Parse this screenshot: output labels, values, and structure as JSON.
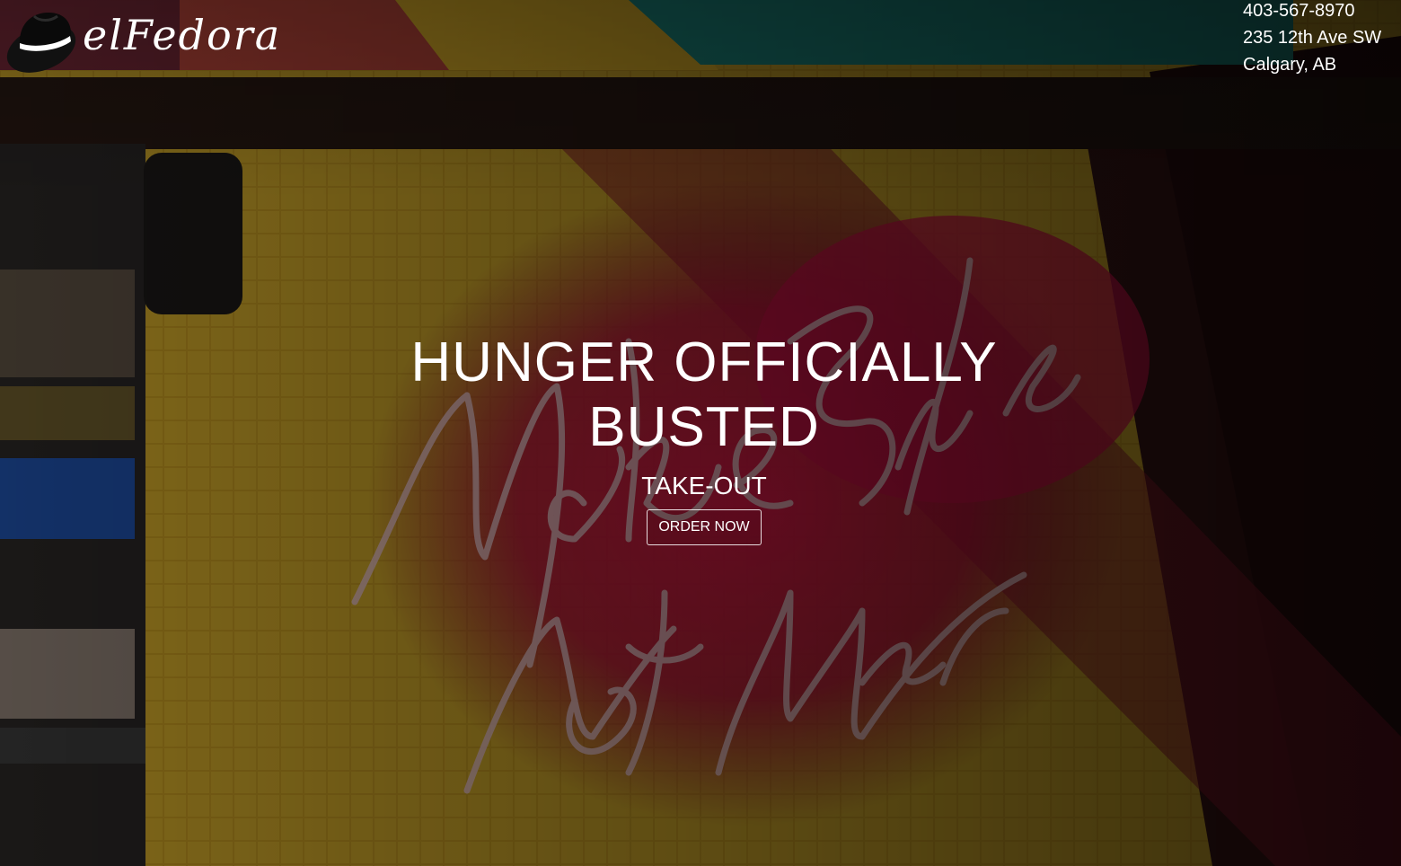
{
  "brand": {
    "logo_text": "elFedora",
    "logo_icon": "fedora-hat-icon"
  },
  "contact": {
    "phone": "403-567-8970",
    "address_line1": "235 12th Ave SW",
    "address_line2": "Calgary, AB"
  },
  "hero": {
    "headline_line1": "HUNGER OFFICIALLY",
    "headline_line2": "BUSTED",
    "subtitle": "TAKE-OUT",
    "cta_label": "ORDER NOW",
    "background_image": "neon-sign-make-salsa-not-war-on-tiled-wall"
  },
  "colors": {
    "text": "#ffffff",
    "tile_yellow": "#c9a227",
    "neon_red": "#c4103a",
    "teal_awning": "#1e8f86"
  }
}
